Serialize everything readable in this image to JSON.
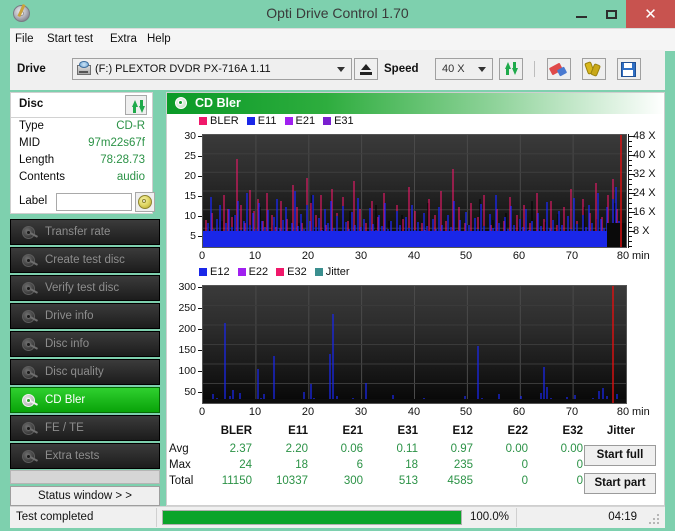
{
  "window": {
    "title": "Opti Drive Control 1.70",
    "icon": "disc-pen-icon",
    "minimize": "–",
    "maximize": "□",
    "close": "✕",
    "accent_green": "#7ed0ae",
    "close_red": "#c8534f"
  },
  "menu": {
    "items": [
      "File",
      "Start test",
      "Extra",
      "Help"
    ]
  },
  "toolbar": {
    "drive_label": "Drive",
    "drive_value": "(F:)  PLEXTOR DVDR  PX-716A 1.11",
    "eject": "eject-icon",
    "speed_label": "Speed",
    "speed_value": "40 X",
    "refresh": "refresh-icon",
    "erase": "erase-icon",
    "tools": "tools-icon",
    "save": "save-icon"
  },
  "disc": {
    "header": "Disc",
    "refresh": "refresh-icon",
    "rows": [
      {
        "key": "Type",
        "value": "CD-R"
      },
      {
        "key": "MID",
        "value": "97m22s67f"
      },
      {
        "key": "Length",
        "value": "78:28.73"
      },
      {
        "key": "Contents",
        "value": "audio"
      }
    ],
    "label_key": "Label",
    "label_value": "",
    "label_placeholder": "",
    "cd_button": "cd-icon"
  },
  "nav": {
    "items": [
      {
        "label": "Transfer rate",
        "selected": false
      },
      {
        "label": "Create test disc",
        "selected": false
      },
      {
        "label": "Verify test disc",
        "selected": false
      },
      {
        "label": "Drive info",
        "selected": false
      },
      {
        "label": "Disc info",
        "selected": false
      },
      {
        "label": "Disc quality",
        "selected": false
      },
      {
        "label": "CD Bler",
        "selected": true
      },
      {
        "label": "FE / TE",
        "selected": false
      },
      {
        "label": "Extra tests",
        "selected": false
      }
    ],
    "status_window": "Status window > >"
  },
  "content": {
    "banner_title": "CD Bler",
    "banner_icon": "disc-icon"
  },
  "actions": {
    "start_full": "Start full",
    "start_part": "Start part"
  },
  "statusbar": {
    "message": "Test completed",
    "percent_label": "100.0%",
    "percent_value": 100,
    "time": "04:19",
    "bar_color": "#0aa42a"
  },
  "stats": {
    "columns": [
      "BLER",
      "E11",
      "E21",
      "E31",
      "E12",
      "E22",
      "E32",
      "Jitter"
    ],
    "rows": [
      {
        "label": "Avg",
        "values": [
          "2.37",
          "2.20",
          "0.06",
          "0.11",
          "0.97",
          "0.00",
          "0.00",
          "-"
        ]
      },
      {
        "label": "Max",
        "values": [
          "24",
          "18",
          "6",
          "18",
          "235",
          "0",
          "0",
          "-"
        ]
      },
      {
        "label": "Total",
        "values": [
          "11150",
          "10337",
          "300",
          "513",
          "4585",
          "0",
          "0",
          ""
        ]
      }
    ]
  },
  "chart_data": [
    {
      "type": "line",
      "id": "cd-bler-top",
      "title": "CD Bler",
      "xlabel": "min",
      "ylabel": "",
      "xlim": [
        0,
        80
      ],
      "ylim": [
        0,
        30
      ],
      "xticks": [
        0,
        10,
        20,
        30,
        40,
        50,
        60,
        70,
        80
      ],
      "yticks": [
        5,
        10,
        15,
        20,
        25,
        30
      ],
      "right_axis_label": "X",
      "right_yticks": [
        "8 X",
        "16 X",
        "24 X",
        "32 X",
        "40 X",
        "48 X"
      ],
      "right_ylim": [
        0,
        52
      ],
      "grid": true,
      "legend_position": "top-left",
      "legend": [
        {
          "name": "BLER",
          "color": "#f0186a"
        },
        {
          "name": "E11",
          "color": "#1a27e8"
        },
        {
          "name": "E21",
          "color": "#a020f0"
        },
        {
          "name": "E31",
          "color": "#7a1fd0"
        }
      ],
      "series": [
        {
          "name": "BLER",
          "color": "#f0186a",
          "max": 24,
          "avg": 2.37,
          "total": 11150
        },
        {
          "name": "E11",
          "color": "#1a27e8",
          "max": 18,
          "avg": 2.2,
          "total": 10337
        },
        {
          "name": "E21",
          "color": "#a020f0",
          "max": 6,
          "avg": 0.06,
          "total": 300
        },
        {
          "name": "E31",
          "color": "#7a1fd0",
          "max": 18,
          "avg": 0.11,
          "total": 513
        }
      ],
      "annotations": [
        "dense spiky BLER/E11 noise across full 0-80 min range",
        "red write-speed marker near 79 min"
      ]
    },
    {
      "type": "line",
      "id": "cd-bler-bottom",
      "title": "",
      "xlabel": "min",
      "ylabel": "",
      "xlim": [
        0,
        80
      ],
      "ylim": [
        0,
        300
      ],
      "xticks": [
        0,
        10,
        20,
        30,
        40,
        50,
        60,
        70,
        80
      ],
      "yticks": [
        50,
        100,
        150,
        200,
        250,
        300
      ],
      "grid": true,
      "legend_position": "top-left",
      "legend": [
        {
          "name": "E12",
          "color": "#1a27e8"
        },
        {
          "name": "E22",
          "color": "#a020f0"
        },
        {
          "name": "E32",
          "color": "#f0186a"
        },
        {
          "name": "Jitter",
          "color": "#3b8f8f"
        }
      ],
      "series": [
        {
          "name": "E12",
          "color": "#1a27e8",
          "max": 235,
          "avg": 0.97,
          "total": 4585
        },
        {
          "name": "E22",
          "color": "#a020f0",
          "max": 0,
          "avg": 0.0,
          "total": 0
        },
        {
          "name": "E32",
          "color": "#f0186a",
          "max": 0,
          "avg": 0.0,
          "total": 0
        },
        {
          "name": "Jitter",
          "color": "#3b8f8f",
          "max": null,
          "avg": null,
          "total": null
        }
      ],
      "annotations": [
        "sparse E12 spikes; tallest ~235 at ~24 min and ~210 at ~5 min",
        "red end-of-disc marker near 79 min"
      ]
    }
  ]
}
